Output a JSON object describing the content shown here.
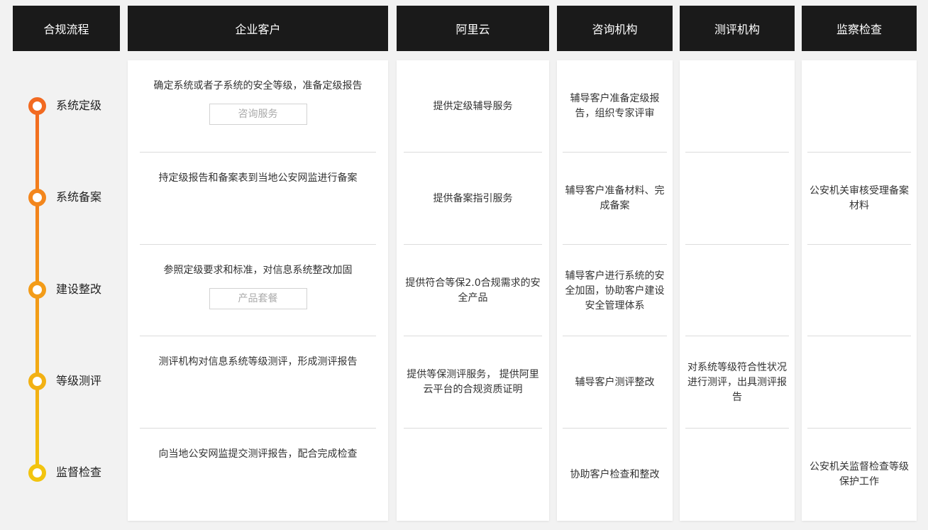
{
  "headers": [
    "合规流程",
    "企业客户",
    "阿里云",
    "咨询机构",
    "测评机构",
    "监察检查"
  ],
  "steps": [
    "系统定级",
    "系统备案",
    "建设整改",
    "等级测评",
    "监督检查"
  ],
  "enterprise": [
    {
      "text": "确定系统或者子系统的安全等级，准备定级报告",
      "tag": "咨询服务"
    },
    {
      "text": "持定级报告和备案表到当地公安网监进行备案"
    },
    {
      "text": "参照定级要求和标准，对信息系统整改加固",
      "tag": "产品套餐"
    },
    {
      "text": "测评机构对信息系统等级测评，形成测评报告"
    },
    {
      "text": "向当地公安网监提交测评报告，配合完成检查"
    }
  ],
  "aliyun": [
    "提供定级辅导服务",
    "提供备案指引服务",
    "提供符合等保2.0合规需求的安全产品",
    "提供等保测评服务， 提供阿里云平台的合规资质证明",
    ""
  ],
  "consulting": [
    "辅导客户准备定级报告，组织专家评审",
    "辅导客户准备材料、完成备案",
    "辅导客户进行系统的安全加固，协助客户建设安全管理体系",
    "辅导客户测评整改",
    "协助客户检查和整改"
  ],
  "assessment": [
    "",
    "",
    "",
    "对系统等级符合性状况进行测评，出具测评报告",
    ""
  ],
  "inspection": [
    "",
    "公安机关审核受理备案材料",
    "",
    "",
    "公安机关监督检查等级保护工作"
  ],
  "colors": {
    "header_bg": "#1a1a1a",
    "timeline_top": "#f26a21",
    "timeline_bottom": "#f2c40f"
  }
}
